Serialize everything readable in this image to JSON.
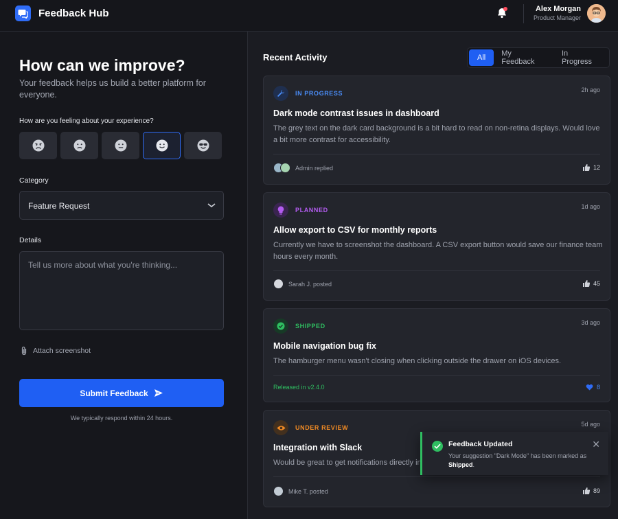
{
  "header": {
    "app_title": "Feedback Hub",
    "user_name": "Alex Morgan",
    "user_role": "Product Manager"
  },
  "form": {
    "title": "How can we improve?",
    "subtitle": "Your feedback helps us build a better platform for everyone.",
    "feeling_label": "How are you feeling about your experience?",
    "moods": [
      "very-dissatisfied",
      "dissatisfied",
      "neutral",
      "satisfied",
      "delighted"
    ],
    "selected_mood": "satisfied",
    "category_label": "Category",
    "category_value": "Feature Request",
    "details_label": "Details",
    "details_placeholder": "Tell us more about what you're thinking...",
    "attach_label": "Attach screenshot",
    "submit_label": "Submit Feedback",
    "respond_note": "We typically respond within 24 hours."
  },
  "activity": {
    "title": "Recent Activity",
    "tabs": [
      "All",
      "My Feedback",
      "In Progress"
    ],
    "active_tab": "All",
    "cards": [
      {
        "status": "IN PROGRESS",
        "status_color": "#4a8df8",
        "icon": "wrench-icon",
        "time": "2h ago",
        "title": "Dark mode contrast issues in dashboard",
        "body": "The grey text on the dark card background is a bit hard to read on non-retina displays. Would love a bit more contrast for accessibility.",
        "footer": "Admin replied",
        "likes": "12"
      },
      {
        "status": "PLANNED",
        "status_color": "#b35cf0",
        "icon": "lightbulb-icon",
        "time": "1d ago",
        "title": "Allow export to CSV for monthly reports",
        "body": "Currently we have to screenshot the dashboard. A CSV export button would save our finance team hours every month.",
        "footer": "Sarah J. posted",
        "likes": "45"
      },
      {
        "status": "SHIPPED",
        "status_color": "#2fbe61",
        "icon": "check-circle-icon",
        "time": "3d ago",
        "title": "Mobile navigation bug fix",
        "body": "The hamburger menu wasn't closing when clicking outside the drawer on iOS devices.",
        "footer": "Released in v2.4.0",
        "likes": "8"
      },
      {
        "status": "UNDER REVIEW",
        "status_color": "#f08a24",
        "icon": "eye-icon",
        "time": "5d ago",
        "title": "Integration with Slack",
        "body": "Would be great to get notifications directly in",
        "footer": "Mike T. posted",
        "likes": "89"
      }
    ]
  },
  "toast": {
    "title": "Feedback Updated",
    "text_prefix": "Your suggestion \"Dark Mode\" has been marked as",
    "text_status": "Shipped",
    "text_suffix": "."
  }
}
